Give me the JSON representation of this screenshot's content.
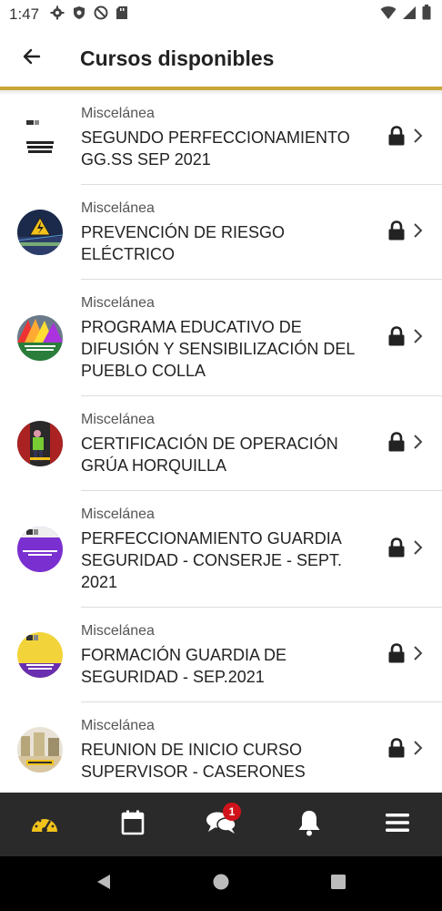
{
  "status_bar": {
    "time": "1:47",
    "left_icons": [
      "gear-icon",
      "shield-icon",
      "no-disturb-icon",
      "sd-card-icon"
    ],
    "right_icons": [
      "wifi-icon",
      "signal-icon",
      "battery-icon"
    ]
  },
  "app_bar": {
    "title": "Cursos disponibles",
    "back_icon": "arrow-left-icon"
  },
  "colors": {
    "accent_gold": "#c9a635",
    "nav_background": "#2a2a2a",
    "badge_red": "#d0131b",
    "dashboard_icon_yellow": "#f2c21b"
  },
  "courses": [
    {
      "category": "Miscelánea",
      "name": "SEGUNDO PERFECCIONAMIENTO GG.SS SEP 2021",
      "thumb": "thumb-white-doc",
      "locked": true
    },
    {
      "category": "Miscelánea",
      "name": "PREVENCIÓN DE RIESGO ELÉCTRICO",
      "thumb": "thumb-electric-warning",
      "locked": true
    },
    {
      "category": "Miscelánea",
      "name": "PROGRAMA EDUCATIVO DE DIFUSIÓN Y SENSIBILIZACIÓN DEL PUEBLO COLLA",
      "thumb": "thumb-colorful-flags",
      "locked": true
    },
    {
      "category": "Miscelánea",
      "name": "CERTIFICACIÓN DE OPERACIÓN GRÚA HORQUILLA",
      "thumb": "thumb-forklift",
      "locked": true
    },
    {
      "category": "Miscelánea",
      "name": "PERFECCIONAMIENTO GUARDIA SEGURIDAD - CONSERJE - SEPT. 2021",
      "thumb": "thumb-purple",
      "locked": true
    },
    {
      "category": "Miscelánea",
      "name": "FORMACIÓN GUARDIA DE SEGURIDAD - SEP.2021",
      "thumb": "thumb-yellow-purple",
      "locked": true
    },
    {
      "category": "Miscelánea",
      "name": "REUNION DE INICIO CURSO SUPERVISOR - CASERONES",
      "thumb": "thumb-construction",
      "locked": true
    }
  ],
  "bottom_nav": {
    "items": [
      "dashboard-icon",
      "calendar-icon",
      "chat-icon",
      "bell-icon",
      "menu-icon"
    ],
    "chat_badge": "1"
  },
  "system_nav": [
    "back-triangle-icon",
    "home-circle-icon",
    "recents-square-icon"
  ]
}
